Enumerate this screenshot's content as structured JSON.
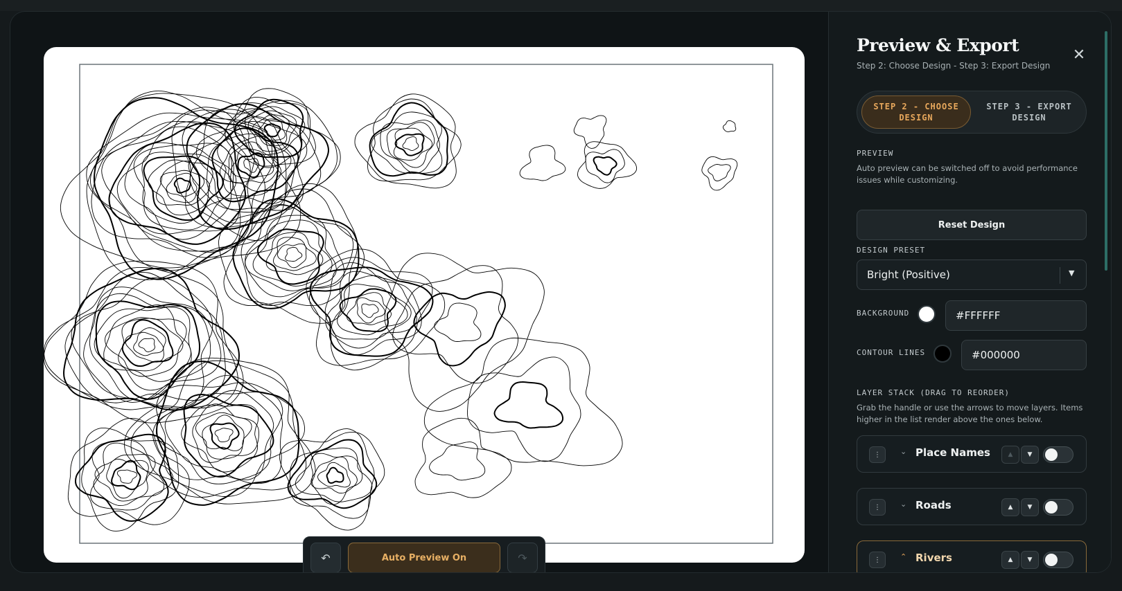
{
  "modal": {
    "title": "Preview & Export",
    "subtitle": "Step 2: Choose Design - Step 3: Export Design",
    "close_icon": "close-icon"
  },
  "steps": {
    "tabs": [
      {
        "label": "STEP 2 - CHOOSE DESIGN",
        "active": true
      },
      {
        "label": "STEP 3 - EXPORT DESIGN",
        "active": false
      }
    ]
  },
  "preview": {
    "heading": "PREVIEW",
    "help": "Auto preview can be switched off to avoid performance issues while customizing.",
    "reset_label": "Reset Design"
  },
  "design_preset": {
    "heading": "DESIGN PRESET",
    "selected": "Bright (Positive)"
  },
  "colors": {
    "background_label": "BACKGROUND",
    "background_value": "#FFFFFF",
    "contour_label": "CONTOUR LINES",
    "contour_value": "#000000"
  },
  "layers": {
    "heading": "LAYER STACK (DRAG TO REORDER)",
    "help": "Grab the handle or use the arrows to move layers. Items higher in the list render above the ones below.",
    "items": [
      {
        "name": "Place Names",
        "expanded": false,
        "enabled": false,
        "up_disabled": true
      },
      {
        "name": "Roads",
        "expanded": false,
        "enabled": false,
        "up_disabled": false
      },
      {
        "name": "Rivers",
        "expanded": true,
        "enabled": false,
        "up_disabled": false
      }
    ]
  },
  "toolbar": {
    "undo_icon": "undo-icon",
    "auto_preview_label": "Auto Preview On",
    "redo_icon": "redo-icon"
  },
  "map": {
    "background": "#FFFFFF",
    "line_color": "#000000"
  }
}
